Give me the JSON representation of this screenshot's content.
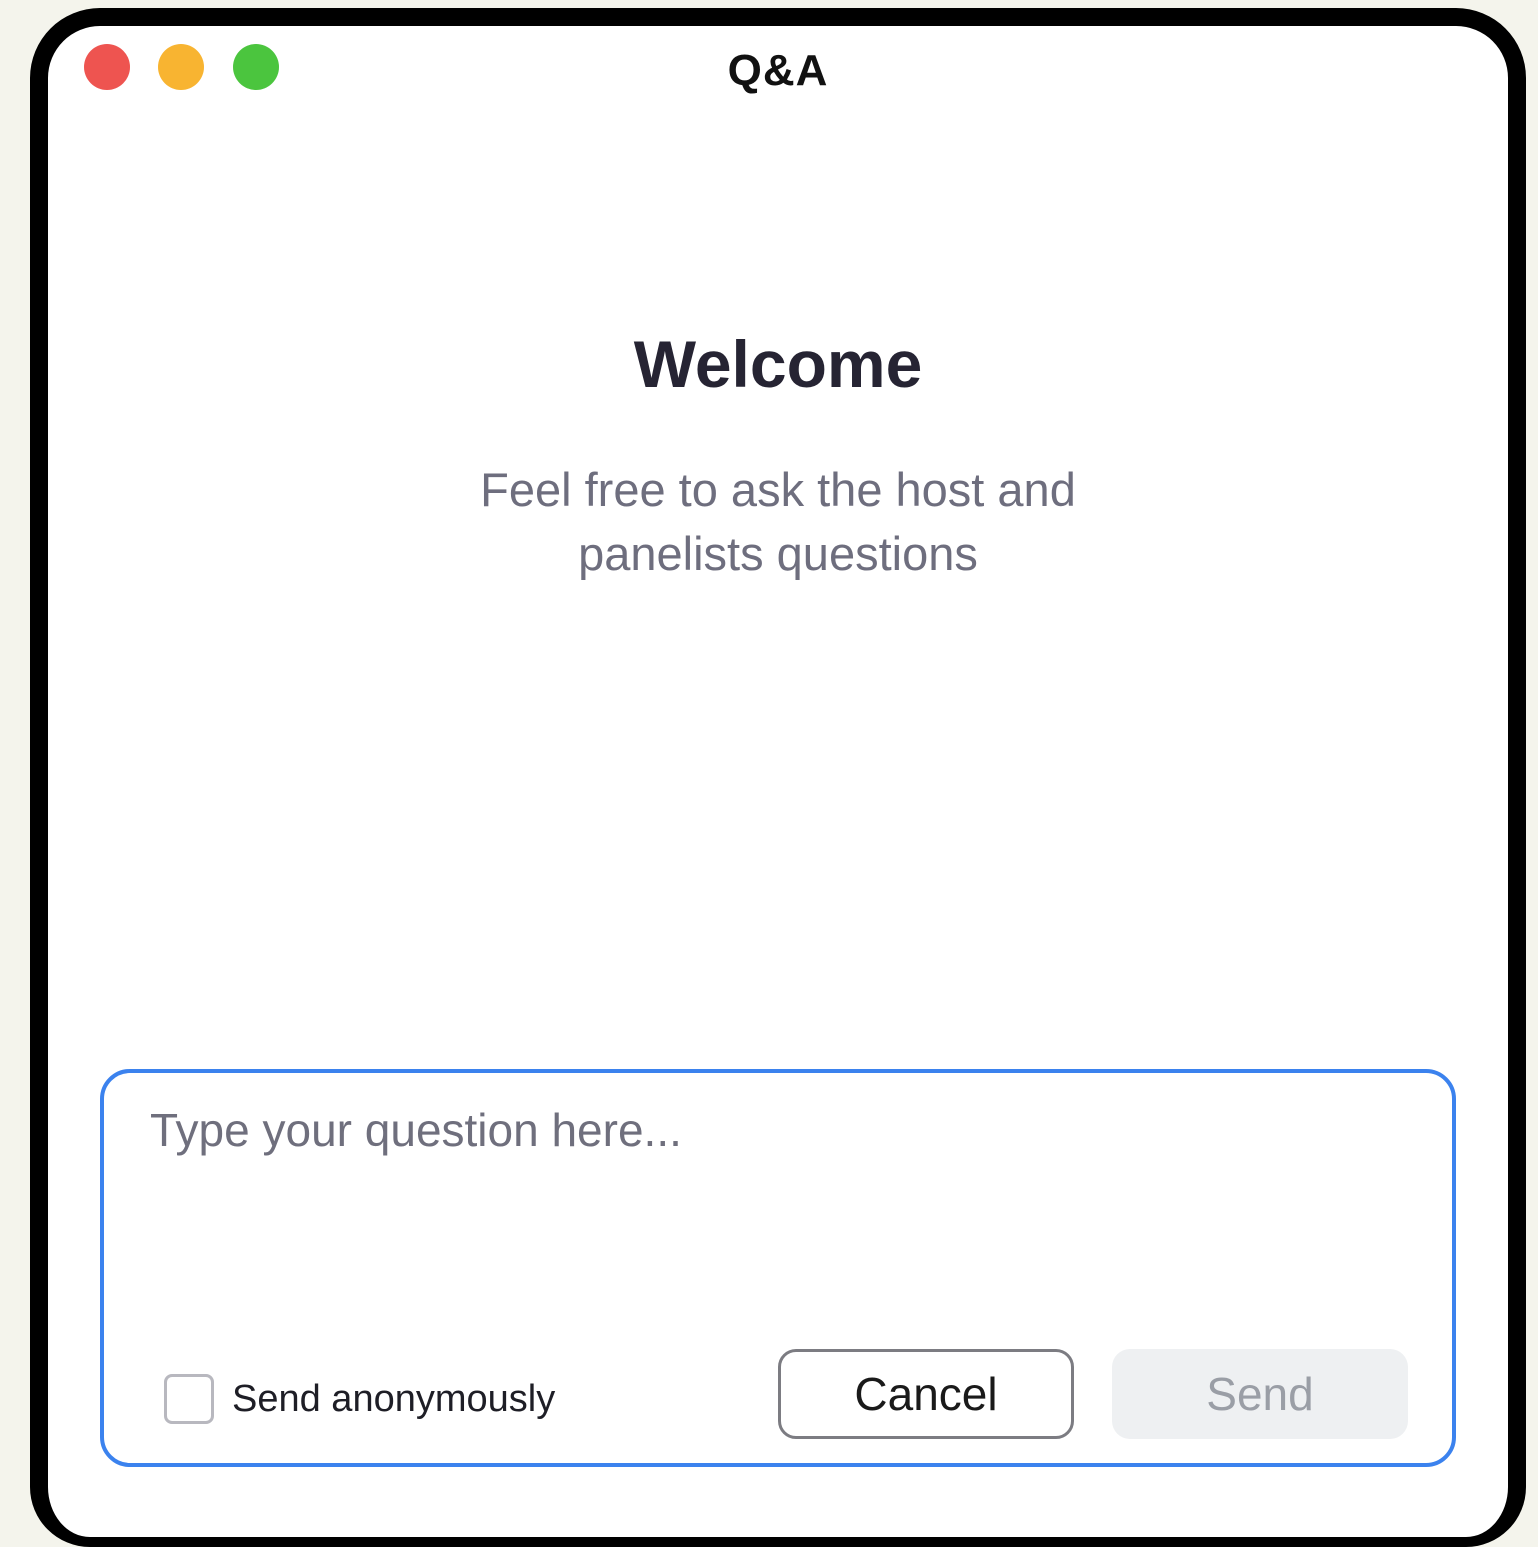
{
  "window": {
    "title": "Q&A"
  },
  "traffic_lights": {
    "close_color": "#ee5450",
    "minimize_color": "#f8b431",
    "maximize_color": "#4bc53e"
  },
  "welcome": {
    "heading": "Welcome",
    "subtitle_line1": "Feel free to ask the host and",
    "subtitle_line2": "panelists questions"
  },
  "compose": {
    "placeholder": "Type your question here...",
    "value": "",
    "anonymous_label": "Send anonymously",
    "anonymous_checked": false,
    "cancel_label": "Cancel",
    "send_label": "Send",
    "send_enabled": false,
    "accent_color": "#3b82ee"
  }
}
